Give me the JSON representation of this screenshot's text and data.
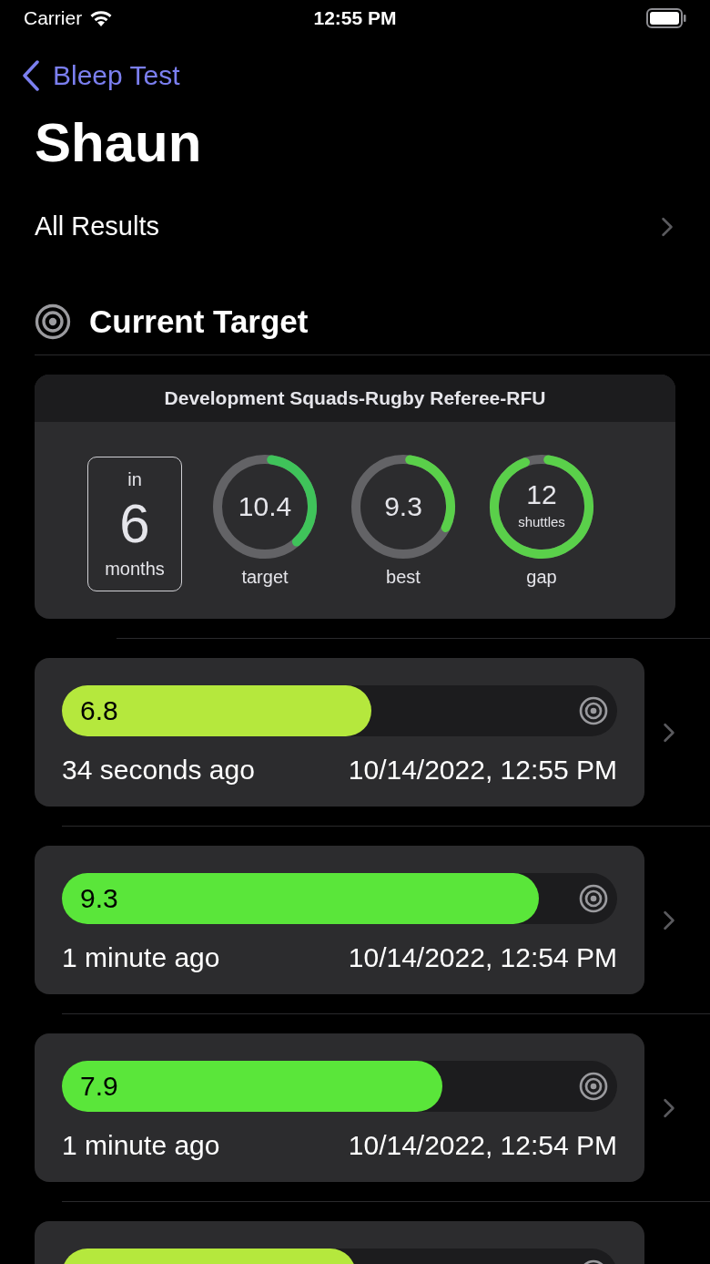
{
  "status_bar": {
    "carrier": "Carrier",
    "time": "12:55 PM"
  },
  "nav": {
    "back": "Bleep Test"
  },
  "title": "Shaun",
  "all_results": "All Results",
  "section": {
    "title": "Current Target"
  },
  "target_card": {
    "title": "Development Squads-Rugby Referee-RFU",
    "countdown": {
      "prefix": "in",
      "value": "6",
      "unit": "months"
    },
    "rings": [
      {
        "value": "10.4",
        "caption": "target",
        "level": 0.36,
        "color": "#3fc35a"
      },
      {
        "value": "9.3",
        "caption": "best",
        "level": 0.3,
        "color": "#5ad04a"
      },
      {
        "value": "12",
        "sub": "shuttles",
        "caption": "gap",
        "level": 0.92,
        "color": "#5ad04a"
      }
    ]
  },
  "results": [
    {
      "score": "6.8",
      "level": 0.557,
      "color": "#b5e83d",
      "ago": "34 seconds ago",
      "date": "10/14/2022, 12:55 PM"
    },
    {
      "score": "9.3",
      "level": 0.859,
      "color": "#5ae63a",
      "ago": "1 minute ago",
      "date": "10/14/2022, 12:54 PM"
    },
    {
      "score": "7.9",
      "level": 0.685,
      "color": "#5ae63a",
      "ago": "1 minute ago",
      "date": "10/14/2022, 12:54 PM"
    },
    {
      "level": 0.53,
      "color": "#b5e83d"
    }
  ]
}
